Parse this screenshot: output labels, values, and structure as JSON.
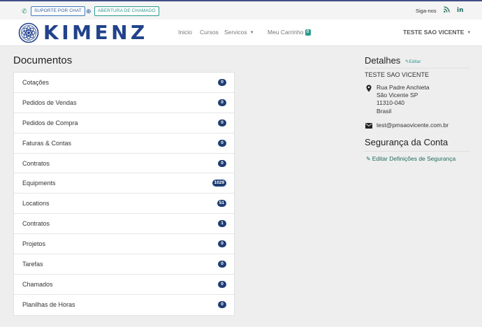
{
  "topbar": {
    "chat_icon": "whatsapp-icon",
    "chat_label": "SUPORTE POR CHAT",
    "ticket_icon": "globe-icon",
    "ticket_label": "ABERTURA DE CHAMADO",
    "follow_label": "Siga-nos",
    "rss_icon": "rss-icon",
    "linkedin_icon": "linkedin-icon",
    "linkedin_text": "in"
  },
  "nav": {
    "logo_text": "KIMENZ",
    "home": "Inicio",
    "courses": "Cursos",
    "services": "Servicos",
    "cart": "Meu Carrinho",
    "cart_count": "0",
    "user": "TESTE SAO VICENTE"
  },
  "documents": {
    "title": "Documentos",
    "items": [
      {
        "label": "Cotações",
        "count": "0"
      },
      {
        "label": "Pedidos de Vendas",
        "count": "0"
      },
      {
        "label": "Pedidos de Compra",
        "count": "0"
      },
      {
        "label": "Faturas & Contas",
        "count": "0"
      },
      {
        "label": "Contratos",
        "count": "0"
      },
      {
        "label": "Equipments",
        "count": "1029"
      },
      {
        "label": "Locations",
        "count": "51"
      },
      {
        "label": "Contratos",
        "count": "1"
      },
      {
        "label": "Projetos",
        "count": "0"
      },
      {
        "label": "Tarefas",
        "count": "0"
      },
      {
        "label": "Chamados",
        "count": "0"
      },
      {
        "label": "Planilhas de Horas",
        "count": "0"
      }
    ]
  },
  "details": {
    "title": "Detalhes",
    "edit": "Editar",
    "name": "TESTE SAO VICENTE",
    "address": [
      "Rua Padre Anchieta",
      "São Vicente SP",
      "11310-040",
      "Brasil"
    ],
    "email": "test@pmsaovicente.com.br"
  },
  "security": {
    "title": "Segurança da Conta",
    "edit_link": "Editar Definições de Segurança"
  },
  "colors": {
    "brand": "#22438c",
    "accent": "#2b9a8e",
    "badge": "#1e3e73"
  }
}
